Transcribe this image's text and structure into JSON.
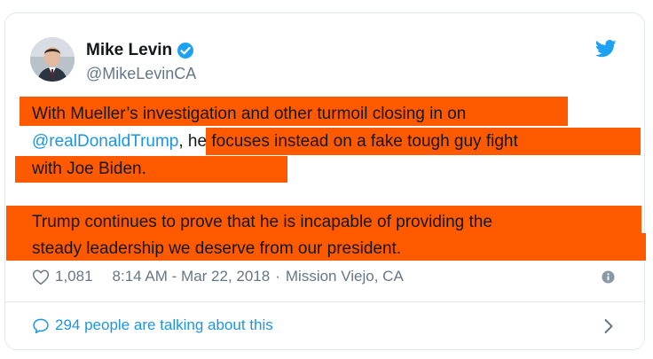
{
  "user": {
    "display_name": "Mike Levin",
    "handle": "@MikeLevinCA",
    "verified": true
  },
  "tweet": {
    "line1": "With Mueller’s investigation and other turmoil closing in on",
    "mention": "@realDonaldTrump",
    "line2_rest": ", he focuses instead on a fake tough guy fight",
    "line3": "with Joe Biden.",
    "line4": "Trump continues to prove that he is incapable of providing the",
    "line5": "steady leadership we deserve from our president."
  },
  "meta": {
    "like_count": "1,081",
    "timestamp": "8:14 AM - Mar 22, 2018",
    "separator": "·",
    "location": "Mission Viejo, CA"
  },
  "footer": {
    "talking_label": "294 people are talking about this"
  },
  "colors": {
    "highlight": "#ff5a00",
    "link": "#1b95e0",
    "muted": "#657786",
    "text": "#14171a",
    "border": "#e1e8ed"
  },
  "icons": [
    "verified-icon",
    "bird-icon",
    "heart-icon",
    "info-icon",
    "comment-bubble-icon",
    "chevron-right-icon"
  ]
}
